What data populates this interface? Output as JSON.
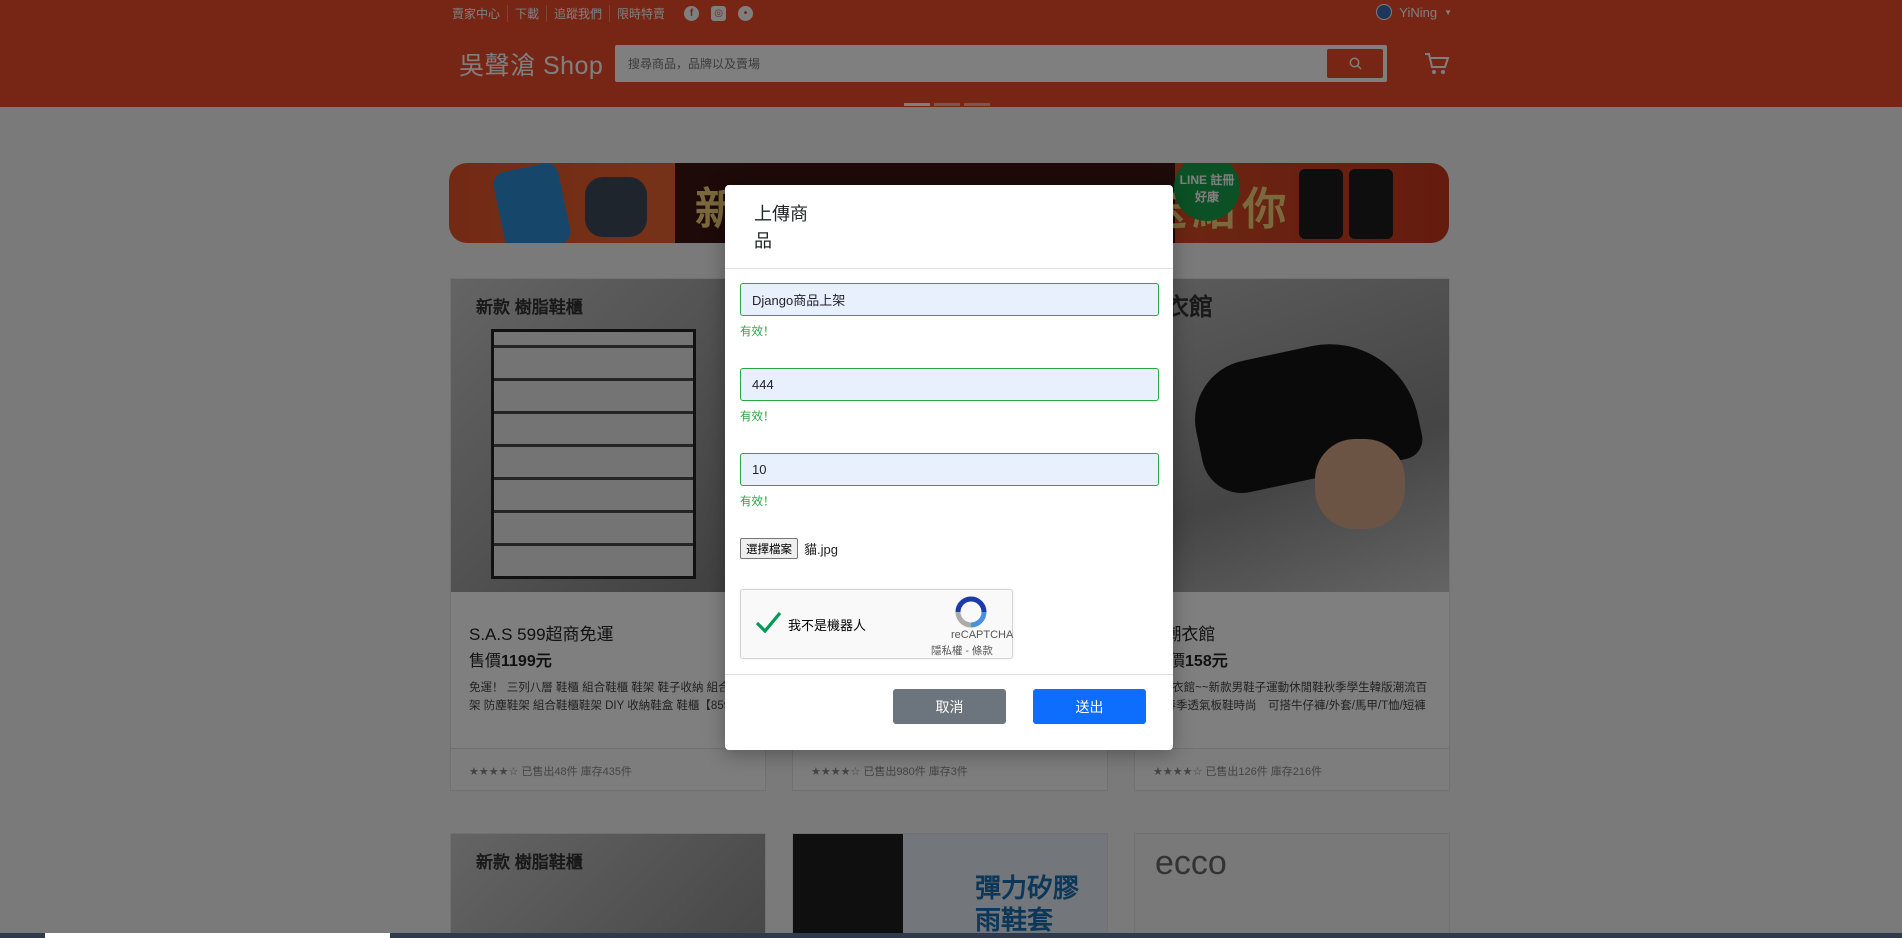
{
  "topbar": {
    "links": [
      "賣家中心",
      "下載",
      "追蹤我們",
      "限時特賣"
    ],
    "username": "YiNing"
  },
  "header": {
    "logo": "吳聲滄 Shop",
    "search_placeholder": "搜尋商品，品牌以及賣場"
  },
  "banner": {
    "text": "新會員限定 $0 禮物送給你",
    "badge": "LINE 註冊好康"
  },
  "products": [
    {
      "title": "S.A.S 599超商免運",
      "price_label": "售價",
      "price": "1199元",
      "desc": "免運！ 三列八層 鞋櫃 組合鞋櫃 鞋架 鞋子收納 組合鞋架 防塵鞋架 組合鞋櫃鞋架 DIY 收納鞋盒 鞋櫃【859H】",
      "image_text": "新款 樹脂鞋櫃",
      "footer": "★★★★☆ 已售出48件 庫存435件"
    },
    {
      "title": "",
      "price_label": "",
      "price": "",
      "desc": "",
      "image_text": "",
      "footer": "★★★★☆ 已售出980件 庫存3件"
    },
    {
      "title": "B潮衣館",
      "price_label": "售價",
      "price": "158元",
      "desc": "B潮衣館~~新款男鞋子運動休閒鞋秋季學生韓版潮流百搭春季透氣板鞋時尚　可搭牛仔褲/外套/馬甲/T恤/短褲",
      "image_text": "衣館",
      "footer": "★★★★☆ 已售出126件 庫存216件"
    }
  ],
  "products_row2_text": [
    "新款 樹脂鞋櫃",
    "彈力矽膠 雨鞋套",
    "ecco"
  ],
  "modal": {
    "title": "上傳商品",
    "fields": [
      {
        "value": "Django商品上架",
        "feedback": "有效！"
      },
      {
        "value": "444",
        "feedback": "有效！"
      },
      {
        "value": "10",
        "feedback": "有效！"
      }
    ],
    "file_button": "選擇檔案",
    "file_name": "貓.jpg",
    "captcha": {
      "label": "我不是機器人",
      "brand": "reCAPTCHA",
      "terms": "隱私權 - 條款"
    },
    "cancel_label": "取消",
    "submit_label": "送出"
  },
  "colors": {
    "brand": "#ee4d2d",
    "valid": "#28a745",
    "submit": "#0d6efd",
    "cancel": "#6c757d"
  }
}
